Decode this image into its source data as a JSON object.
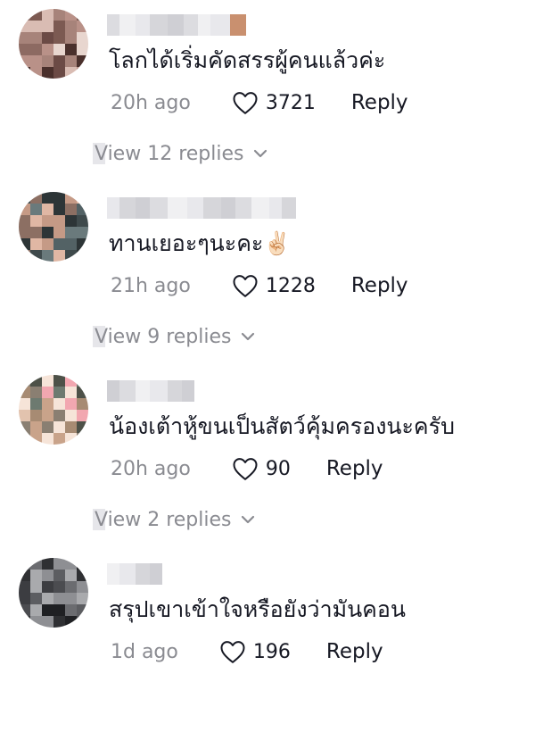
{
  "comments": [
    {
      "text": "โลกได้เริ่มคัดสรรผู้คนแล้วค่ะ",
      "time": "20h ago",
      "likes": "3721",
      "reply_label": "Reply",
      "view_replies": "View 12 replies",
      "avatar_icon": "pixelated-avatar"
    },
    {
      "text": "ทานเยอะๆนะคะ✌🏻",
      "time": "21h ago",
      "likes": "1228",
      "reply_label": "Reply",
      "view_replies": "View 9 replies",
      "avatar_icon": "pixelated-avatar"
    },
    {
      "text": "น้องเต้าหู้ขนเป็นสัตว์คุ้มครองนะครับ",
      "time": "20h ago",
      "likes": "90",
      "reply_label": "Reply",
      "view_replies": "View 2 replies",
      "avatar_icon": "pixelated-avatar"
    },
    {
      "text": "สรุปเขาเข้าใจหรือยังว่ามันคอน",
      "time": "1d ago",
      "likes": "196",
      "reply_label": "Reply",
      "avatar_icon": "pixelated-avatar"
    }
  ],
  "icons": {
    "like": "heart-outline-icon",
    "expand": "chevron-down-icon"
  },
  "colors": {
    "primary_text": "#161823",
    "secondary_text": "#8a8b91",
    "background": "#ffffff"
  }
}
